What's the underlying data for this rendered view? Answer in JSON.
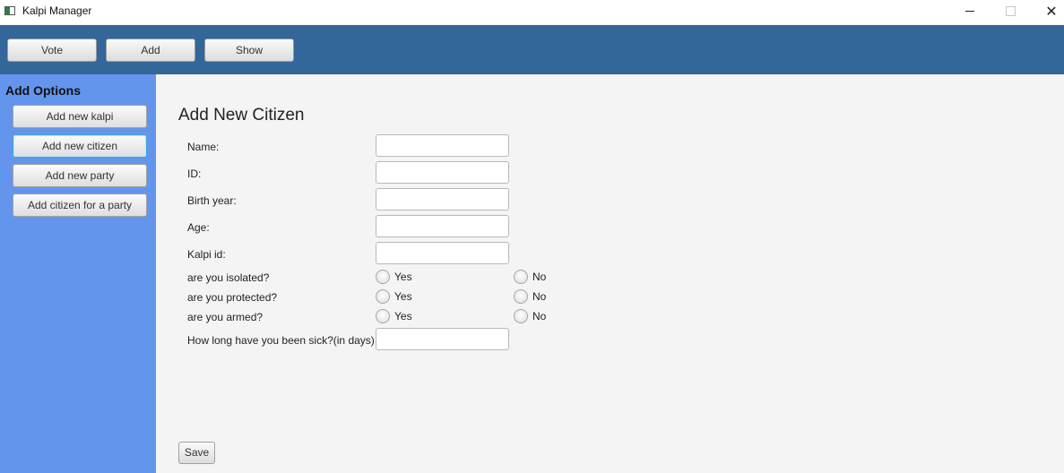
{
  "window": {
    "title": "Kalpi Manager",
    "min_icon": "minimize-icon",
    "max_icon": "maximize-icon",
    "close_icon": "close-icon",
    "close_glyph": "✕"
  },
  "toolbar": {
    "vote_label": "Vote",
    "add_label": "Add",
    "show_label": "Show"
  },
  "sidebar": {
    "title": "Add Options",
    "items": [
      {
        "label": "Add new kalpi"
      },
      {
        "label": "Add new citizen"
      },
      {
        "label": "Add new party"
      },
      {
        "label": "Add citizen for a party"
      }
    ]
  },
  "form": {
    "heading": "Add New Citizen",
    "fields": [
      {
        "label": "Name:",
        "value": ""
      },
      {
        "label": "ID:",
        "value": ""
      },
      {
        "label": "Birth year:",
        "value": ""
      },
      {
        "label": "Age:",
        "value": ""
      },
      {
        "label": "Kalpi id:",
        "value": ""
      }
    ],
    "questions": [
      {
        "label": "are you isolated?",
        "yes": "Yes",
        "no": "No"
      },
      {
        "label": "are you protected?",
        "yes": "Yes",
        "no": "No"
      },
      {
        "label": "are you armed?",
        "yes": "Yes",
        "no": "No"
      }
    ],
    "sick_label": "How long have you been sick?(in days)",
    "sick_value": "",
    "save_label": "Save"
  },
  "colors": {
    "toolbar_bg": "#336699",
    "sidebar_bg": "#6495ed",
    "focus_border": "#39a7d9"
  }
}
